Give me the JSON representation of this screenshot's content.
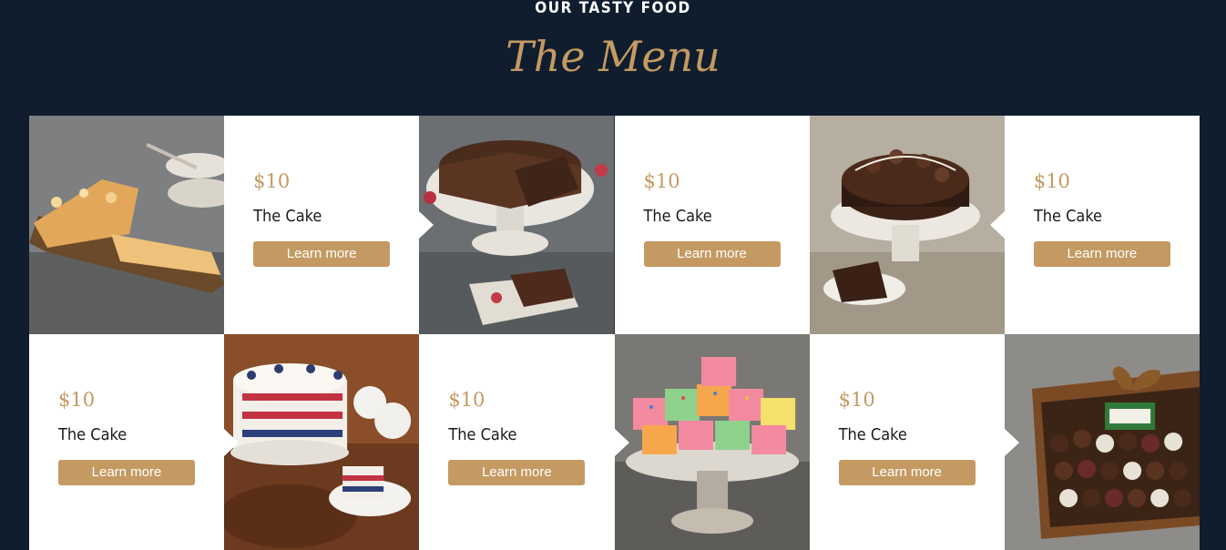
{
  "header": {
    "eyebrow": "OUR TASTY FOOD",
    "title": "The Menu"
  },
  "menu_items": [
    {
      "price": "$10",
      "name": "The Cake",
      "button": "Learn more",
      "image": "almond-pound-cake"
    },
    {
      "price": "$10",
      "name": "The Cake",
      "button": "Learn more",
      "image": "chocolate-cake"
    },
    {
      "price": "$10",
      "name": "The Cake",
      "button": "Learn more",
      "image": "chocolate-truffle-cake"
    },
    {
      "price": "$10",
      "name": "The Cake",
      "button": "Learn more",
      "image": "red-white-blue-layer-cake"
    },
    {
      "price": "$10",
      "name": "The Cake",
      "button": "Learn more",
      "image": "petits-fours"
    },
    {
      "price": "$10",
      "name": "The Cake",
      "button": "Learn more",
      "image": "chocolate-truffles-box"
    }
  ],
  "colors": {
    "background": "#101d2e",
    "accent": "#c49a62",
    "card": "#ffffff"
  }
}
